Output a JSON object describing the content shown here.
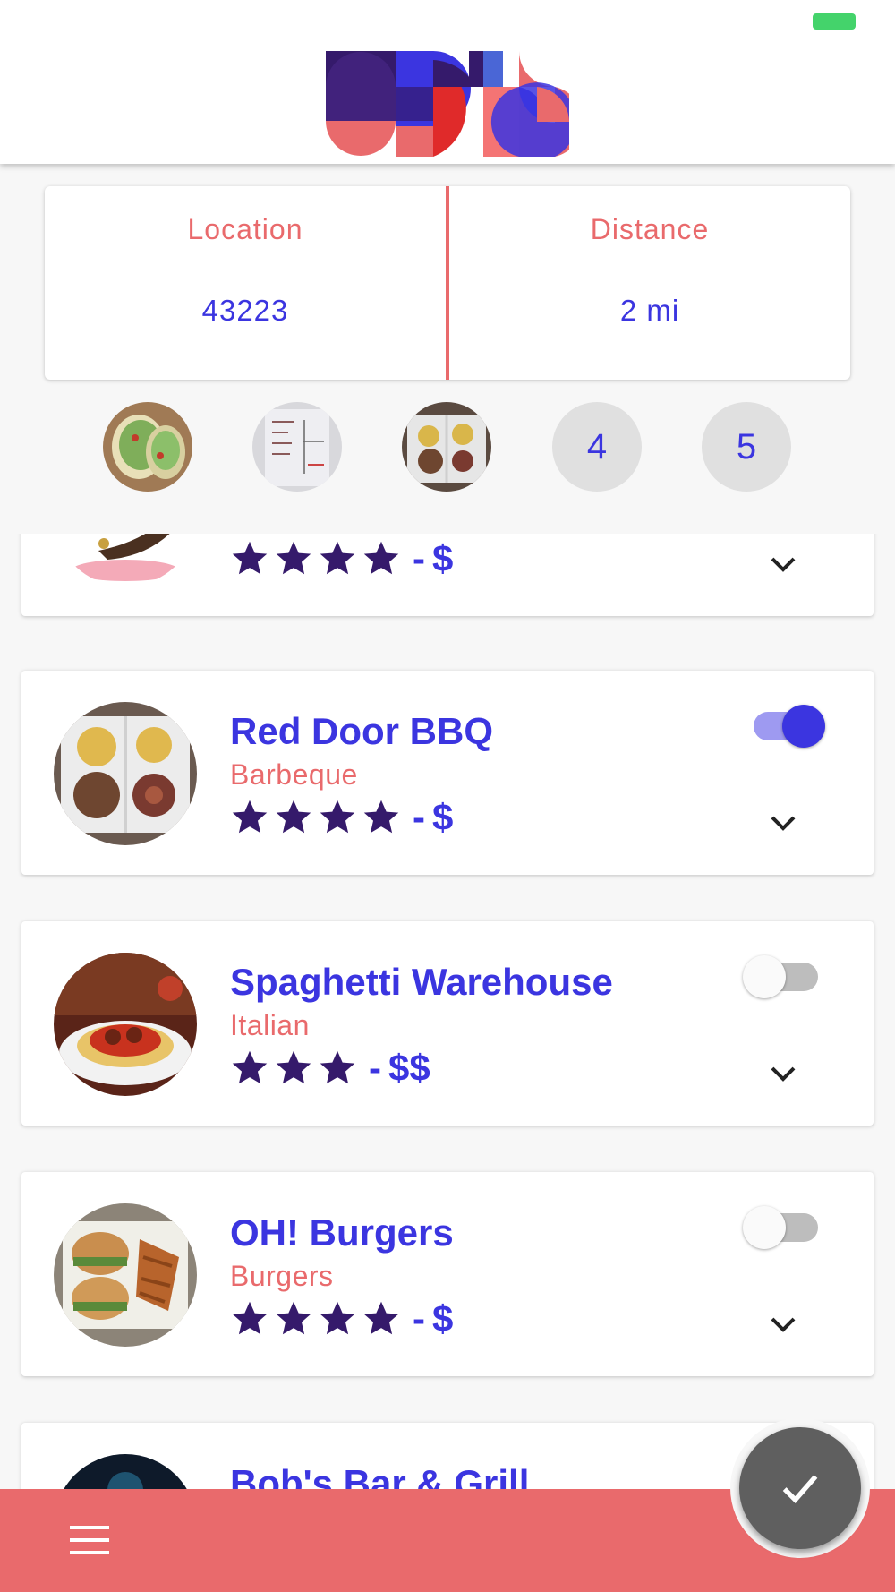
{
  "colors": {
    "brand_blue": "#3b35e0",
    "brand_coral": "#e96a6c",
    "star_purple": "#351a6b",
    "success_green": "#44d36b",
    "toggle_on_track": "#9e9af1",
    "toggle_off_track": "#bdbdbd",
    "fab_gray": "#5f5f5f"
  },
  "header": {
    "logo_icon": "geometric-brand-logo-icon"
  },
  "filters": {
    "location_label": "Location",
    "location_value": "43223",
    "distance_label": "Distance",
    "distance_value": "2 mi"
  },
  "steps": [
    {
      "type": "image",
      "icon": "tacos-thumbnail"
    },
    {
      "type": "image",
      "icon": "paper-menu-thumbnail"
    },
    {
      "type": "image",
      "icon": "bbq-platter-thumbnail"
    },
    {
      "type": "number",
      "label": "4"
    },
    {
      "type": "number",
      "label": "5"
    }
  ],
  "restaurants": [
    {
      "name": "",
      "cuisine": "",
      "stars": 4,
      "separator": "-",
      "price": "$",
      "selected": null,
      "image_icon": "cookie-promo-image"
    },
    {
      "name": "Red Door BBQ",
      "cuisine": "Barbeque",
      "stars": 4,
      "separator": "-",
      "price": "$",
      "selected": true,
      "image_icon": "bbq-platter-image"
    },
    {
      "name": "Spaghetti Warehouse",
      "cuisine": "Italian",
      "stars": 3,
      "separator": "-",
      "price": "$$",
      "selected": false,
      "image_icon": "spaghetti-plate-image"
    },
    {
      "name": "OH! Burgers",
      "cuisine": "Burgers",
      "stars": 4,
      "separator": "-",
      "price": "$",
      "selected": false,
      "image_icon": "burgers-fries-image"
    },
    {
      "name": "Bob's Bar & Grill",
      "cuisine": "",
      "stars": 0,
      "separator": "",
      "price": "",
      "selected": false,
      "image_icon": "bar-grill-image"
    }
  ],
  "bottom_bar": {
    "menu_icon": "hamburger-menu-icon",
    "fab_icon": "checkmark-icon"
  }
}
